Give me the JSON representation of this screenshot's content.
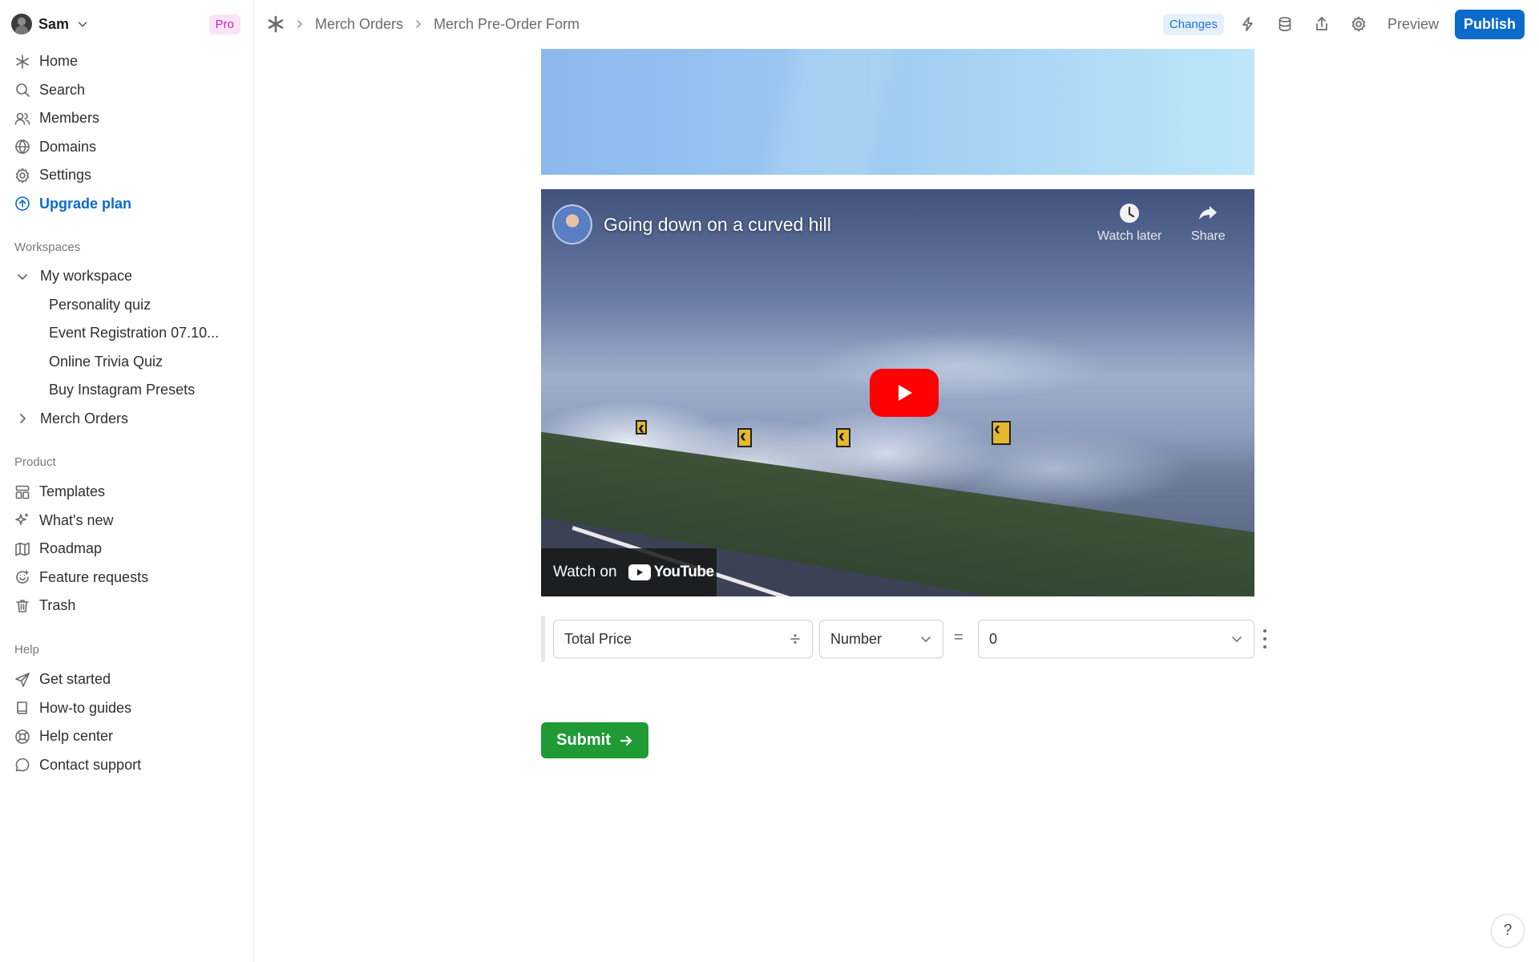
{
  "user": {
    "name": "Sam",
    "plan_badge": "Pro"
  },
  "nav": {
    "items": [
      {
        "label": "Home",
        "icon": "asterisk-icon"
      },
      {
        "label": "Search",
        "icon": "search-icon"
      },
      {
        "label": "Members",
        "icon": "members-icon"
      },
      {
        "label": "Domains",
        "icon": "globe-icon"
      },
      {
        "label": "Settings",
        "icon": "gear-icon"
      }
    ],
    "upgrade_label": "Upgrade plan"
  },
  "workspaces": {
    "title": "Workspaces",
    "workspace_name": "My workspace",
    "forms": [
      "Personality quiz",
      "Event Registration 07.10...",
      "Online Trivia Quiz",
      "Buy Instagram Presets"
    ],
    "collapsed_folder": "Merch Orders"
  },
  "product": {
    "title": "Product",
    "items": [
      "Templates",
      "What's new",
      "Roadmap",
      "Feature requests",
      "Trash"
    ]
  },
  "help": {
    "title": "Help",
    "items": [
      "Get started",
      "How-to guides",
      "Help center",
      "Contact support"
    ]
  },
  "topbar": {
    "breadcrumb": [
      "Merch Orders",
      "Merch Pre-Order Form"
    ],
    "changes_label": "Changes",
    "preview_label": "Preview",
    "publish_label": "Publish"
  },
  "video": {
    "title": "Going down on a curved hill",
    "watch_later": "Watch later",
    "share": "Share",
    "watch_on": "Watch on",
    "platform": "YouTube"
  },
  "formula": {
    "field_name": "Total Price",
    "type": "Number",
    "operator": "=",
    "value": "0"
  },
  "submit_label": "Submit",
  "help_fab": "?",
  "colors": {
    "accent": "#0b6bcb",
    "submit": "#1f9a35",
    "pro_badge_text": "#c02fa6",
    "pro_badge_bg": "#fbe4f7"
  }
}
